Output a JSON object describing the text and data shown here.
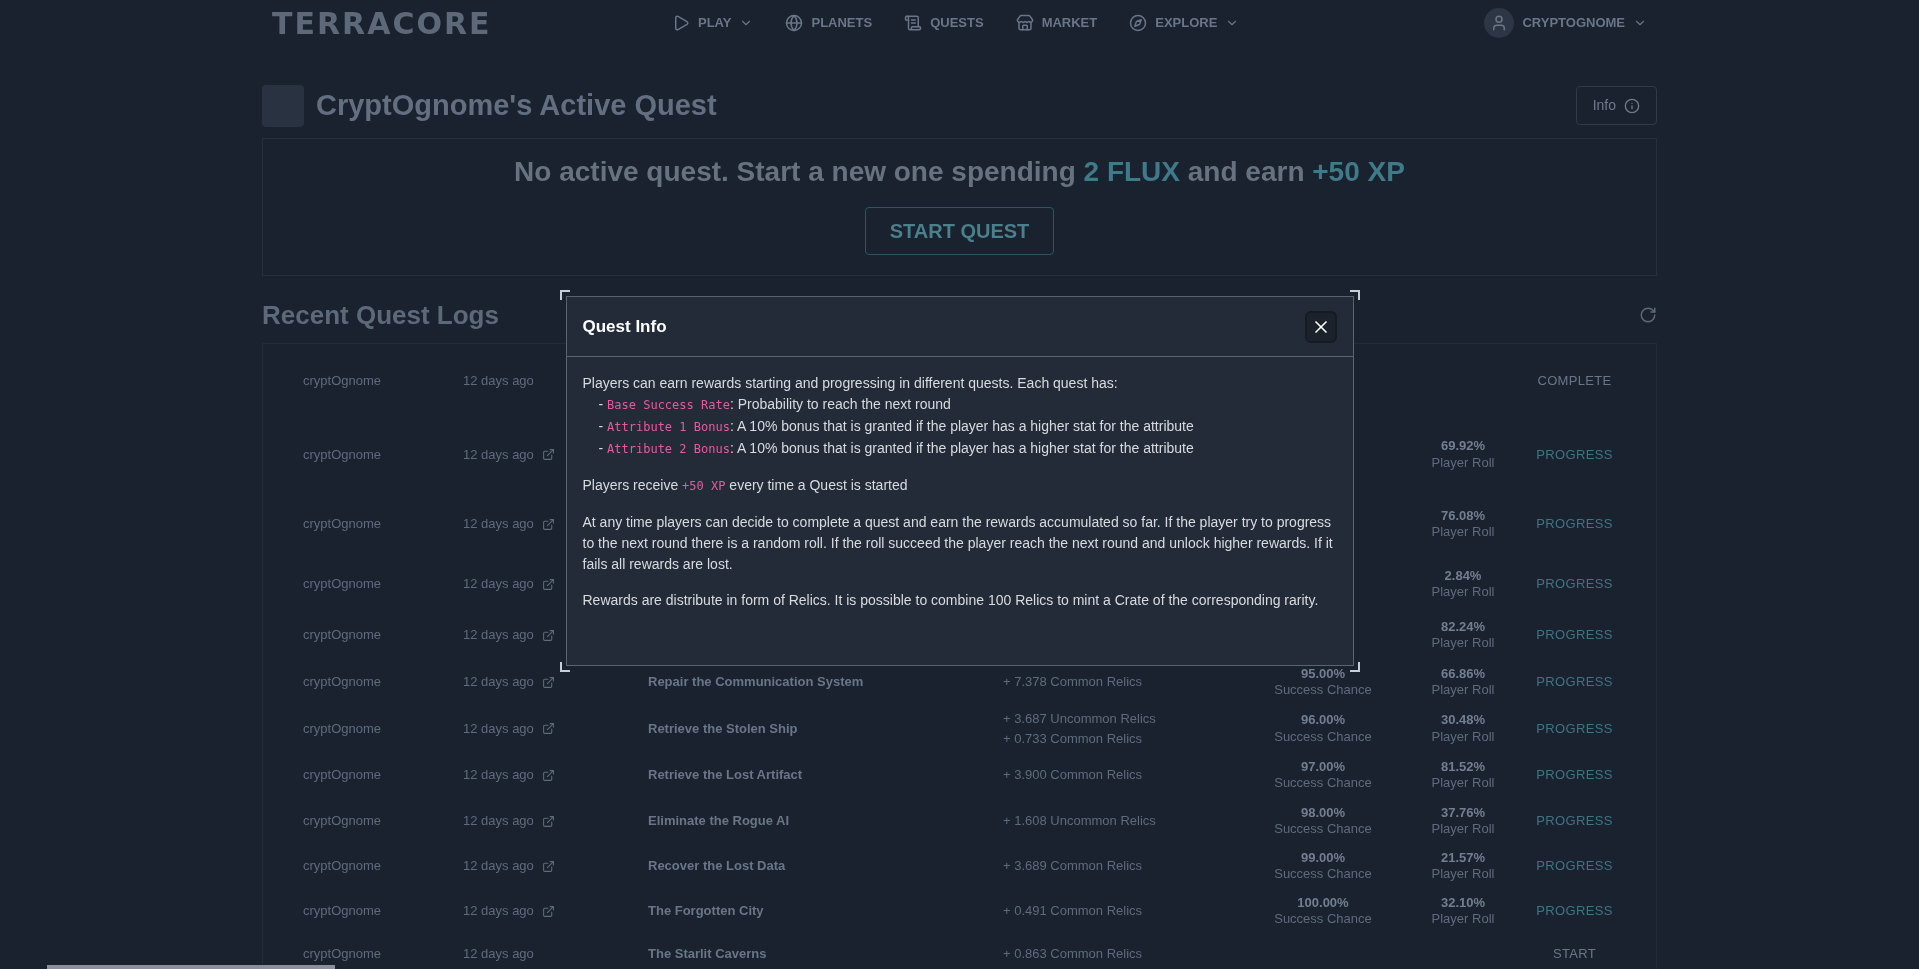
{
  "nav": {
    "logo": "TERRACORE",
    "items": [
      {
        "label": "PLAY",
        "dropdown": true
      },
      {
        "label": "PLANETS",
        "dropdown": false
      },
      {
        "label": "QUESTS",
        "dropdown": false
      },
      {
        "label": "MARKET",
        "dropdown": false
      },
      {
        "label": "EXPLORE",
        "dropdown": true
      }
    ],
    "user": {
      "name": "CRYPTOGNOME",
      "dropdown": true
    }
  },
  "active_quest": {
    "title": "CryptOgnome's Active Quest",
    "info_button": "Info",
    "message": [
      {
        "kind": "text",
        "text": "No active quest. Start a new one spending"
      },
      {
        "kind": "highlight",
        "text": "2 FLUX"
      },
      {
        "kind": "text",
        "text": "and earn"
      },
      {
        "kind": "highlight",
        "text": "+50 XP"
      }
    ],
    "button": "START QUEST"
  },
  "logs": {
    "title": "Recent Quest Logs",
    "rows": [
      {
        "user": "cryptOgnome",
        "time": "12 days ago",
        "link": false,
        "action": "COMPLETE"
      },
      {
        "user": "cryptOgnome",
        "time": "12 days ago",
        "link": true,
        "roll": "69.92%",
        "roll_label": "Player Roll",
        "action": "PROGRESS"
      },
      {
        "user": "cryptOgnome",
        "time": "12 days ago",
        "link": true,
        "roll": "76.08%",
        "roll_label": "Player Roll",
        "action": "PROGRESS"
      },
      {
        "user": "cryptOgnome",
        "time": "12 days ago",
        "link": true,
        "roll": "2.84%",
        "roll_label": "Player Roll",
        "action": "PROGRESS"
      },
      {
        "user": "cryptOgnome",
        "time": "12 days ago",
        "link": true,
        "roll": "82.24%",
        "roll_label": "Player Roll",
        "action": "PROGRESS"
      },
      {
        "user": "cryptOgnome",
        "time": "12 days ago",
        "link": true,
        "quest": "Repair the Communication System",
        "rewards": [
          "+ 7.378 Common Relics"
        ],
        "chance": "95.00%",
        "chance_label": "Success Chance",
        "roll": "66.86%",
        "roll_label": "Player Roll",
        "action": "PROGRESS"
      },
      {
        "user": "cryptOgnome",
        "time": "12 days ago",
        "link": true,
        "quest": "Retrieve the Stolen Ship",
        "rewards": [
          "+ 3.687 Uncommon Relics",
          "+ 0.733 Common Relics"
        ],
        "chance": "96.00%",
        "chance_label": "Success Chance",
        "roll": "30.48%",
        "roll_label": "Player Roll",
        "action": "PROGRESS"
      },
      {
        "user": "cryptOgnome",
        "time": "12 days ago",
        "link": true,
        "quest": "Retrieve the Lost Artifact",
        "rewards": [
          "+ 3.900 Common Relics"
        ],
        "chance": "97.00%",
        "chance_label": "Success Chance",
        "roll": "81.52%",
        "roll_label": "Player Roll",
        "action": "PROGRESS"
      },
      {
        "user": "cryptOgnome",
        "time": "12 days ago",
        "link": true,
        "quest": "Eliminate the Rogue AI",
        "rewards": [
          "+ 1.608 Uncommon Relics"
        ],
        "chance": "98.00%",
        "chance_label": "Success Chance",
        "roll": "37.76%",
        "roll_label": "Player Roll",
        "action": "PROGRESS"
      },
      {
        "user": "cryptOgnome",
        "time": "12 days ago",
        "link": true,
        "quest": "Recover the Lost Data",
        "rewards": [
          "+ 3.689 Common Relics"
        ],
        "chance": "99.00%",
        "chance_label": "Success Chance",
        "roll": "21.57%",
        "roll_label": "Player Roll",
        "action": "PROGRESS"
      },
      {
        "user": "cryptOgnome",
        "time": "12 days ago",
        "link": true,
        "quest": "The Forgotten City",
        "rewards": [
          "+ 0.491 Common Relics"
        ],
        "chance": "100.00%",
        "chance_label": "Success Chance",
        "roll": "32.10%",
        "roll_label": "Player Roll",
        "action": "PROGRESS"
      },
      {
        "user": "cryptOgnome",
        "time": "12 days ago",
        "link": false,
        "quest": "The Starlit Caverns",
        "rewards": [
          "+ 0.863 Common Relics"
        ],
        "action": "START"
      }
    ]
  },
  "modal": {
    "title": "Quest Info",
    "intro": "Players can earn rewards starting and progressing in different quests. Each quest has:",
    "items": [
      {
        "marker": "-",
        "term": "Base Success Rate",
        "text": ": Probability to reach the next round"
      },
      {
        "marker": "-",
        "term": "Attribute 1 Bonus",
        "text": ": A 10% bonus that is granted if the player has a higher stat for the attribute"
      },
      {
        "marker": "-",
        "term": "Attribute 2 Bonus",
        "text": ": A 10% bonus that is granted if the player has a higher stat for the attribute"
      }
    ],
    "paragraphs": [
      [
        {
          "kind": "text",
          "text": "Players receive "
        },
        {
          "kind": "code",
          "text": "+50 XP"
        },
        {
          "kind": "text",
          "text": " every time a Quest is started"
        }
      ],
      [
        {
          "kind": "text",
          "text": "At any time players can decide to complete a quest and earn the rewards accumulated so far. If the player try to progress to the next round there is a random roll. If the roll succeed the player reach the next round and unlock higher rewards. If it fails all rewards are lost."
        }
      ],
      [
        {
          "kind": "text",
          "text": "Rewards are distribute in form of Relics. It is possible to combine 100 Relics to mint a Crate of the corresponding rarity."
        }
      ]
    ]
  }
}
